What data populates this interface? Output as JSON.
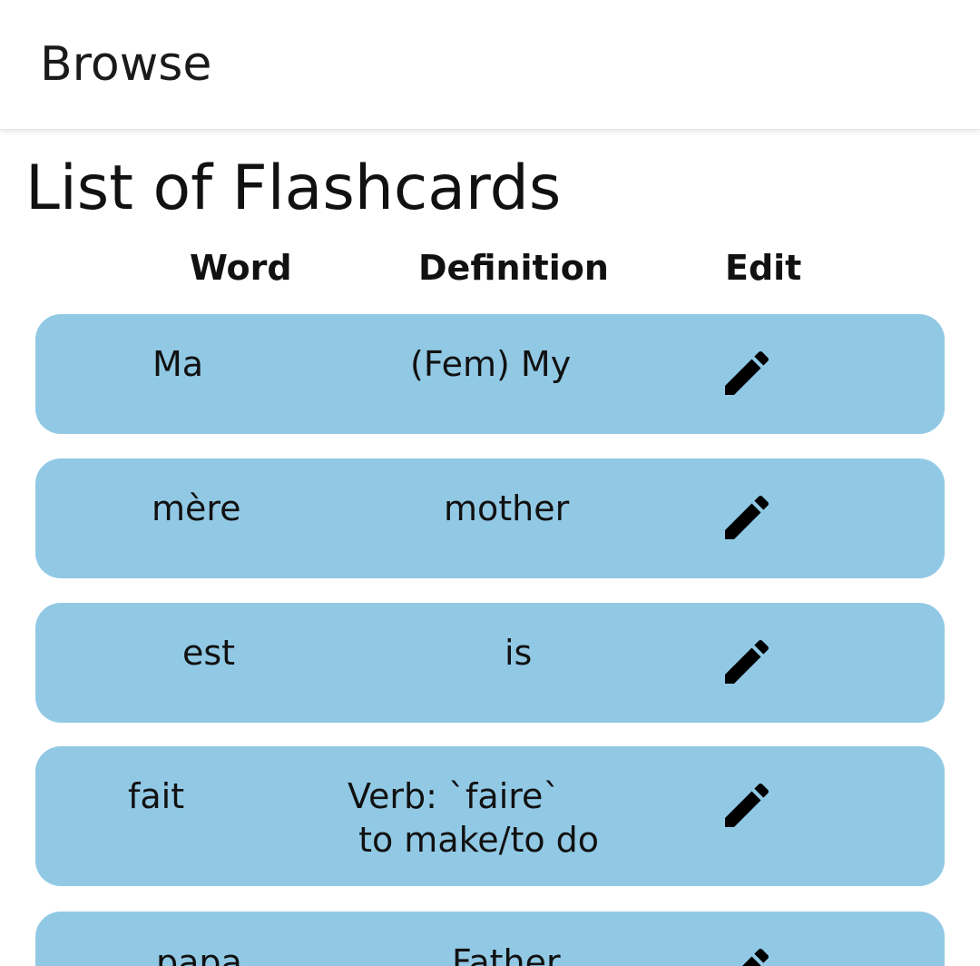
{
  "app_bar": {
    "title": "Browse"
  },
  "page": {
    "title": "List of Flashcards"
  },
  "table": {
    "headers": {
      "word": "Word",
      "definition": "Definition",
      "edit": "Edit"
    },
    "rows": [
      {
        "word": "Ma",
        "definition": "(Fem) My",
        "edit_icon": "pencil-icon"
      },
      {
        "word": "mère",
        "definition": "mother",
        "edit_icon": "pencil-icon"
      },
      {
        "word": "est",
        "definition": "is",
        "edit_icon": "pencil-icon"
      },
      {
        "word": "fait",
        "definition": "Verb: `faire`\n to make/to do",
        "edit_icon": "pencil-icon"
      },
      {
        "word": "papa",
        "definition": "Father",
        "edit_icon": "pencil-icon"
      }
    ]
  },
  "colors": {
    "card_background": "#91c9e5",
    "app_bar_background": "#ffffff",
    "text": "#111111"
  }
}
